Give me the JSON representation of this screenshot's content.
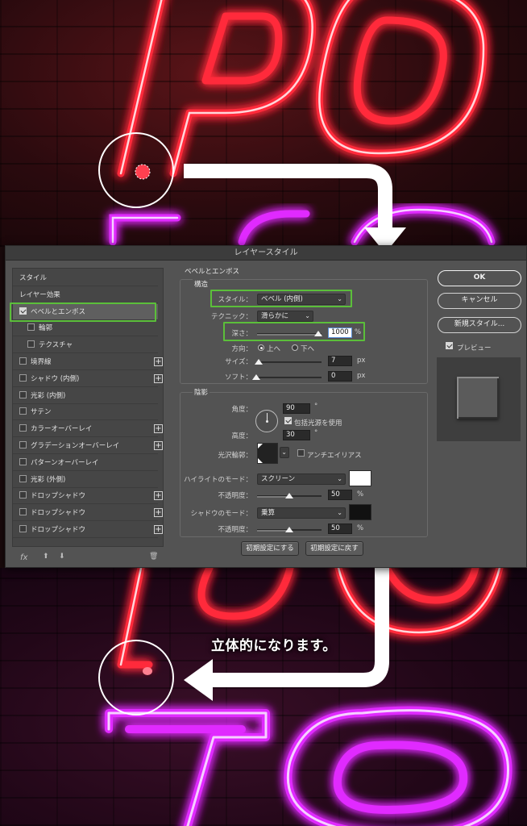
{
  "caption": "立体的になります。",
  "dialog": {
    "title": "レイヤースタイル",
    "left_panel": {
      "items": [
        {
          "label": "スタイル",
          "checkbox": false,
          "checked": false,
          "plus": false,
          "selected": false,
          "indent": false
        },
        {
          "label": "レイヤー効果",
          "checkbox": false,
          "checked": false,
          "plus": false,
          "selected": false,
          "indent": false
        },
        {
          "label": "ベベルとエンボス",
          "checkbox": true,
          "checked": true,
          "plus": false,
          "selected": true,
          "indent": false
        },
        {
          "label": "輪郭",
          "checkbox": true,
          "checked": false,
          "plus": false,
          "selected": false,
          "indent": true
        },
        {
          "label": "テクスチャ",
          "checkbox": true,
          "checked": false,
          "plus": false,
          "selected": false,
          "indent": true
        },
        {
          "label": "境界線",
          "checkbox": true,
          "checked": false,
          "plus": true,
          "selected": false,
          "indent": false
        },
        {
          "label": "シャドウ (内側)",
          "checkbox": true,
          "checked": false,
          "plus": true,
          "selected": false,
          "indent": false
        },
        {
          "label": "光彩 (内側)",
          "checkbox": true,
          "checked": false,
          "plus": false,
          "selected": false,
          "indent": false
        },
        {
          "label": "サテン",
          "checkbox": true,
          "checked": false,
          "plus": false,
          "selected": false,
          "indent": false
        },
        {
          "label": "カラーオーバーレイ",
          "checkbox": true,
          "checked": false,
          "plus": true,
          "selected": false,
          "indent": false
        },
        {
          "label": "グラデーションオーバーレイ",
          "checkbox": true,
          "checked": false,
          "plus": true,
          "selected": false,
          "indent": false
        },
        {
          "label": "パターンオーバーレイ",
          "checkbox": true,
          "checked": false,
          "plus": false,
          "selected": false,
          "indent": false
        },
        {
          "label": "光彩 (外側)",
          "checkbox": true,
          "checked": false,
          "plus": false,
          "selected": false,
          "indent": false
        },
        {
          "label": "ドロップシャドウ",
          "checkbox": true,
          "checked": false,
          "plus": true,
          "selected": false,
          "indent": false
        },
        {
          "label": "ドロップシャドウ",
          "checkbox": true,
          "checked": false,
          "plus": true,
          "selected": false,
          "indent": false
        },
        {
          "label": "ドロップシャドウ",
          "checkbox": true,
          "checked": false,
          "plus": true,
          "selected": false,
          "indent": false
        }
      ],
      "footer": {
        "fx": "fx",
        "up": "⬆",
        "down": "⬇",
        "trash": "🗑"
      }
    },
    "bevel": {
      "section_title": "ベベルとエンボス",
      "structure_title": "構造",
      "style_label": "スタイル：",
      "style_value": "ベベル (内側)",
      "technique_label": "テクニック：",
      "technique_value": "滑らかに",
      "depth_label": "深さ：",
      "depth_value": "1000",
      "depth_unit": "%",
      "direction_label": "方向：",
      "direction_up": "上へ",
      "direction_down": "下へ",
      "size_label": "サイズ：",
      "size_value": "7",
      "size_unit": "px",
      "soften_label": "ソフト：",
      "soften_value": "0",
      "soften_unit": "px"
    },
    "shading": {
      "title": "陰影",
      "angle_label": "角度：",
      "angle_value": "90",
      "angle_unit": "°",
      "global_light_label": "包括光源を使用",
      "altitude_label": "高度：",
      "altitude_value": "30",
      "altitude_unit": "°",
      "gloss_label": "光沢輪郭：",
      "antialias_label": "アンチエイリアス",
      "highlight_mode_label": "ハイライトのモード：",
      "highlight_mode_value": "スクリーン",
      "highlight_color": "#ffffff",
      "highlight_opacity_label": "不透明度：",
      "highlight_opacity_value": "50",
      "highlight_opacity_unit": "%",
      "shadow_mode_label": "シャドウのモード：",
      "shadow_mode_value": "乗算",
      "shadow_color": "#111111",
      "shadow_opacity_label": "不透明度：",
      "shadow_opacity_value": "50",
      "shadow_opacity_unit": "%"
    },
    "buttons": {
      "make_default": "初期設定にする",
      "reset_default": "初期設定に戻す",
      "ok": "OK",
      "cancel": "キャンセル",
      "new_style": "新規スタイル...",
      "preview": "プレビュー"
    }
  },
  "colors": {
    "neon_red": "#ff2b3a",
    "neon_magenta": "#e02cff",
    "highlight_green": "#5bbf3a"
  }
}
